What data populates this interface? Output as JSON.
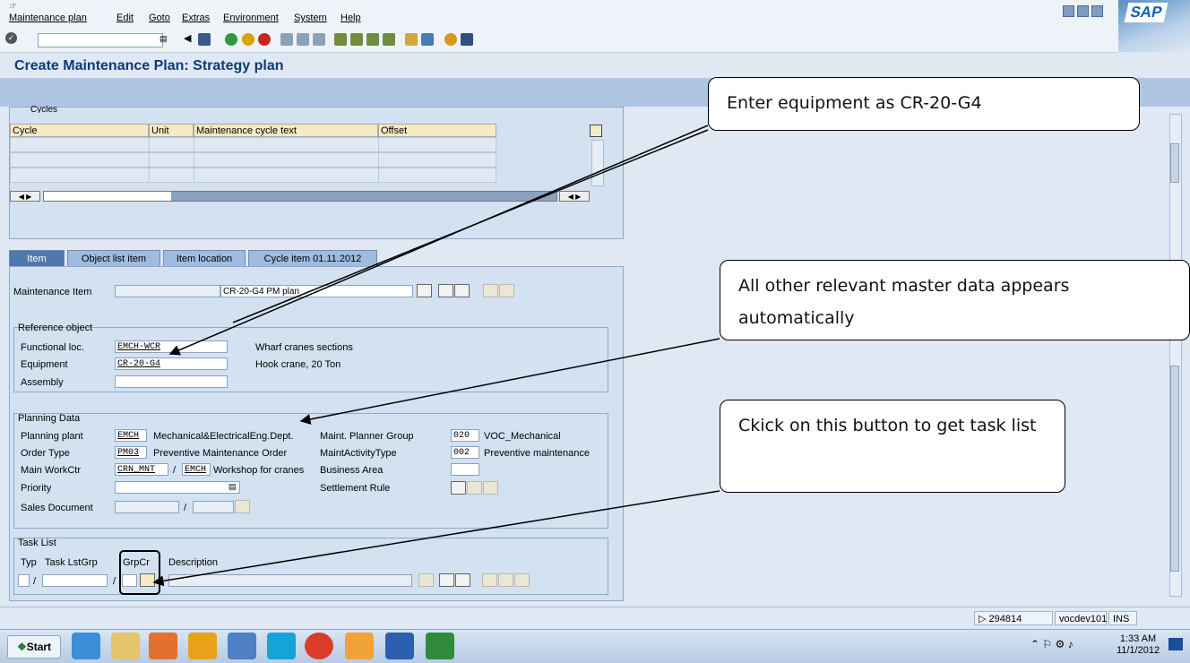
{
  "menubar": {
    "items": [
      "Maintenance plan",
      "Edit",
      "Goto",
      "Extras",
      "Environment",
      "System",
      "Help"
    ],
    "logo": "SAP"
  },
  "title": "Create Maintenance Plan: Strategy plan",
  "cycles": {
    "group_title": "Cycles",
    "columns": [
      "Cycle",
      "Unit",
      "Maintenance cycle text",
      "Offset"
    ]
  },
  "tabs": [
    "Item",
    "Object list item",
    "Item location",
    "Cycle item 01.11.2012"
  ],
  "item": {
    "maintenance_item_label": "Maintenance Item",
    "maintenance_item_value": "",
    "maintenance_item_text": "CR-20-G4 PM plan"
  },
  "reference_object": {
    "group_title": "Reference object",
    "functional_loc_label": "Functional loc.",
    "functional_loc_value": "EMCH-WCR",
    "functional_loc_text": "Wharf cranes sections",
    "equipment_label": "Equipment",
    "equipment_value": "CR-20-G4",
    "equipment_text": "Hook crane, 20 Ton",
    "assembly_label": "Assembly",
    "assembly_value": ""
  },
  "planning_data": {
    "group_title": "Planning Data",
    "planning_plant_label": "Planning plant",
    "planning_plant_value": "EMCH",
    "planning_plant_text": "Mechanical&ElectricalEng.Dept.",
    "order_type_label": "Order Type",
    "order_type_value": "PM03",
    "order_type_text": "Preventive Maintenance Order",
    "main_workctr_label": "Main WorkCtr",
    "main_workctr_value": "CRN_MNT",
    "main_workctr_sep": "/",
    "main_workctr_plant": "EMCH",
    "main_workctr_text": "Workshop for cranes",
    "priority_label": "Priority",
    "sales_document_label": "Sales Document",
    "sales_sep": "/",
    "planner_group_label": "Maint. Planner Group",
    "planner_group_value": "020",
    "planner_group_text": "VOC_Mechanical",
    "activity_type_label": "MaintActivityType",
    "activity_type_value": "002",
    "activity_type_text": "Preventive maintenance",
    "business_area_label": "Business Area",
    "settlement_rule_label": "Settlement Rule"
  },
  "task_list": {
    "group_title": "Task List",
    "typ_label": "Typ",
    "grp_label": "Task LstGrp",
    "grpcr_label": "GrpCr",
    "description_label": "Description",
    "sep1": "/",
    "sep2": "/"
  },
  "callouts": {
    "equipment": "Enter equipment as CR-20-G4",
    "master_data": "All other relevant master data appears automatically",
    "task_list": "Ckick on this button to get task list"
  },
  "status": {
    "session": "294814",
    "server": "vocdev101",
    "mode": "INS"
  },
  "taskbar": {
    "start": "Start",
    "time": "1:33 AM",
    "date": "11/1/2012"
  },
  "colors": {
    "title": "#0e3a78",
    "tab_active": "#4f78ad",
    "panel": "#d3e1f1",
    "grid_header": "#f5e9c6"
  }
}
